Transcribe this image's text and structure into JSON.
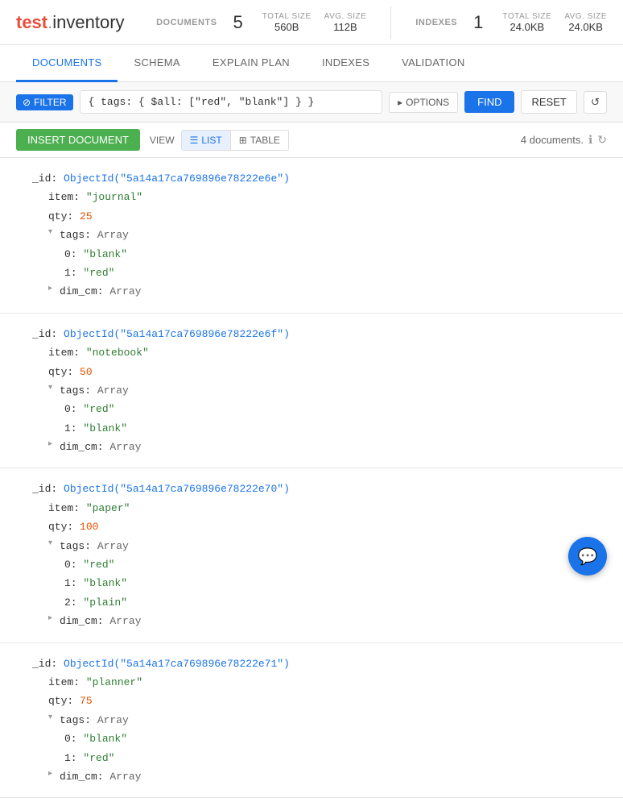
{
  "app": {
    "title_highlight": "test",
    "title_rest": ".inventory"
  },
  "header": {
    "documents_label": "DOCUMENTS",
    "documents_count": "5",
    "total_size_label": "TOTAL SIZE",
    "documents_total_size": "560B",
    "avg_size_label": "AVG. SIZE",
    "documents_avg_size": "112B",
    "indexes_label": "INDEXES",
    "indexes_count": "1",
    "indexes_total_size": "24.0KB",
    "indexes_avg_size": "24.0KB"
  },
  "tabs": [
    {
      "id": "documents",
      "label": "DOCUMENTS",
      "active": true
    },
    {
      "id": "schema",
      "label": "SCHEMA",
      "active": false
    },
    {
      "id": "explain_plan",
      "label": "EXPLAIN PLAN",
      "active": false
    },
    {
      "id": "indexes",
      "label": "INDEXES",
      "active": false
    },
    {
      "id": "validation",
      "label": "VALIDATION",
      "active": false
    }
  ],
  "toolbar": {
    "filter_label": "FILTER",
    "filter_value": "{ tags: { $all: [\"red\", \"blank\"] } }",
    "options_label": "OPTIONS",
    "find_label": "FIND",
    "reset_label": "RESET"
  },
  "actions": {
    "insert_label": "INSERT DOCUMENT",
    "view_label": "VIEW",
    "list_label": "LIST",
    "table_label": "TABLE",
    "doc_count": "4 documents."
  },
  "documents": [
    {
      "id": "ObjectId(\"5a14a17ca769896e78222e6e\")",
      "item": "\"journal\"",
      "qty": "25",
      "tags": "Array",
      "tags_items": [
        {
          "index": "0:",
          "value": "\"blank\""
        },
        {
          "index": "1:",
          "value": "\"red\""
        }
      ],
      "dim_cm": "Array"
    },
    {
      "id": "ObjectId(\"5a14a17ca769896e78222e6f\")",
      "item": "\"notebook\"",
      "qty": "50",
      "tags": "Array",
      "tags_items": [
        {
          "index": "0:",
          "value": "\"red\""
        },
        {
          "index": "1:",
          "value": "\"blank\""
        }
      ],
      "dim_cm": "Array"
    },
    {
      "id": "ObjectId(\"5a14a17ca769896e78222e70\")",
      "item": "\"paper\"",
      "qty": "100",
      "tags": "Array",
      "tags_items": [
        {
          "index": "0:",
          "value": "\"red\""
        },
        {
          "index": "1:",
          "value": "\"blank\""
        },
        {
          "index": "2:",
          "value": "\"plain\""
        }
      ],
      "dim_cm": "Array"
    },
    {
      "id": "ObjectId(\"5a14a17ca769896e78222e71\")",
      "item": "\"planner\"",
      "qty": "75",
      "tags": "Array",
      "tags_items": [
        {
          "index": "0:",
          "value": "\"blank\""
        },
        {
          "index": "1:",
          "value": "\"red\""
        }
      ],
      "dim_cm": "Array"
    }
  ],
  "icons": {
    "triangle_right": "▸",
    "triangle_down": "▾",
    "list_icon": "☰",
    "table_icon": "⊞",
    "history_icon": "⟳",
    "info_icon": "ℹ",
    "refresh_icon": "↻",
    "options_icon": "▸",
    "chat_icon": "💬"
  }
}
